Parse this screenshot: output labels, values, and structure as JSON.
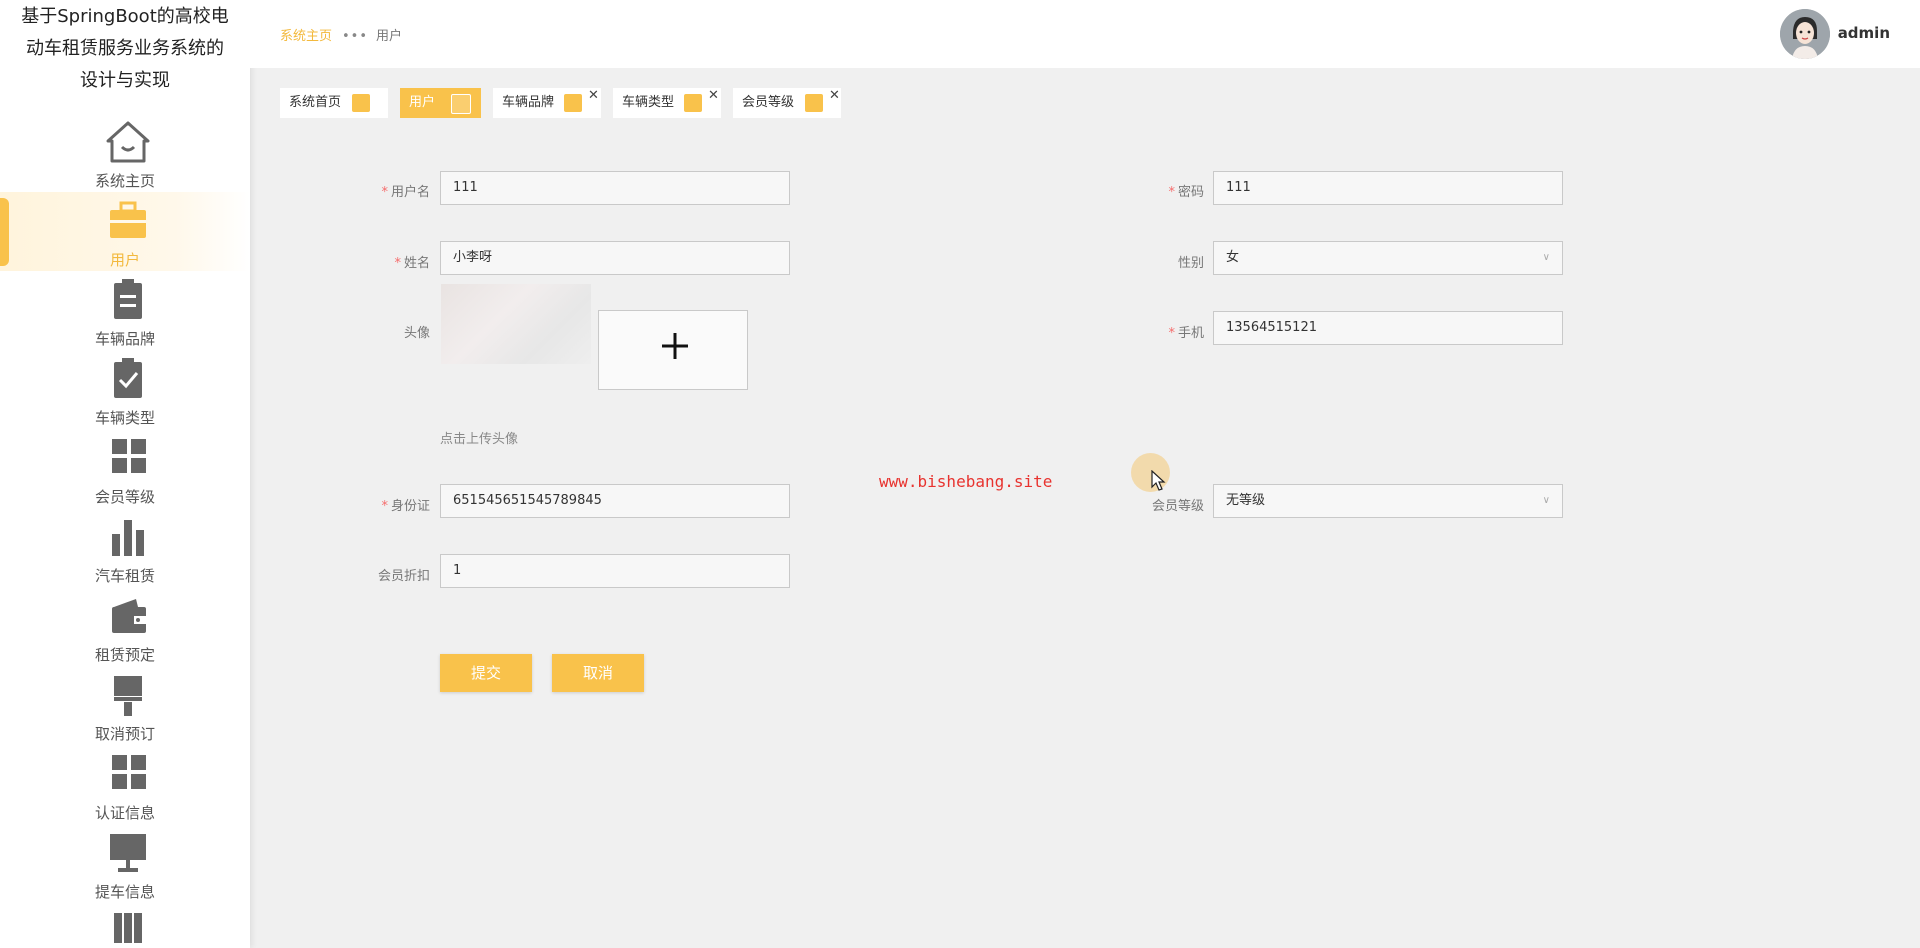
{
  "app_title_lines": [
    "基于SpringBoot的高校电",
    "动车租赁服务业务系统的",
    "设计与实现"
  ],
  "sidebar": {
    "items": [
      {
        "label": "系统主页",
        "icon": "home-icon"
      },
      {
        "label": "用户",
        "icon": "briefcase-icon",
        "active": true
      },
      {
        "label": "车辆品牌",
        "icon": "clipboard-icon"
      },
      {
        "label": "车辆类型",
        "icon": "clipboard-check-icon"
      },
      {
        "label": "会员等级",
        "icon": "grid-icon"
      },
      {
        "label": "汽车租赁",
        "icon": "bar-chart-icon"
      },
      {
        "label": "租赁预定",
        "icon": "wallet-icon"
      },
      {
        "label": "取消预订",
        "icon": "brush-icon"
      },
      {
        "label": "认证信息",
        "icon": "grid-icon"
      },
      {
        "label": "提车信息",
        "icon": "monitor-icon"
      }
    ]
  },
  "breadcrumb": {
    "home": "系统主页",
    "separator": "•••",
    "current": "用户"
  },
  "user": {
    "name": "admin"
  },
  "tabs": [
    {
      "label": "系统首页",
      "closable": false
    },
    {
      "label": "用户",
      "closable": true,
      "active": true
    },
    {
      "label": "车辆品牌",
      "closable": true
    },
    {
      "label": "车辆类型",
      "closable": true
    },
    {
      "label": "会员等级",
      "closable": true
    }
  ],
  "form": {
    "username": {
      "label": "用户名",
      "value": "111",
      "required": true
    },
    "password": {
      "label": "密码",
      "value": "111",
      "required": true
    },
    "name": {
      "label": "姓名",
      "value": "小李呀",
      "required": true
    },
    "gender": {
      "label": "性别",
      "value": "女"
    },
    "avatar": {
      "label": "头像",
      "hint": "点击上传头像"
    },
    "phone": {
      "label": "手机",
      "value": "13564515121",
      "required": true
    },
    "id_card": {
      "label": "身份证",
      "value": "651545651545789845",
      "required": true
    },
    "member_level": {
      "label": "会员等级",
      "value": "无等级"
    },
    "discount": {
      "label": "会员折扣",
      "value": "1"
    },
    "required_mark": "*",
    "submit_label": "提交",
    "cancel_label": "取消"
  },
  "watermark": "www.bishebang.site",
  "colors": {
    "accent": "#f9c24b",
    "required": "#f56c6c",
    "watermark": "#e8332f"
  }
}
